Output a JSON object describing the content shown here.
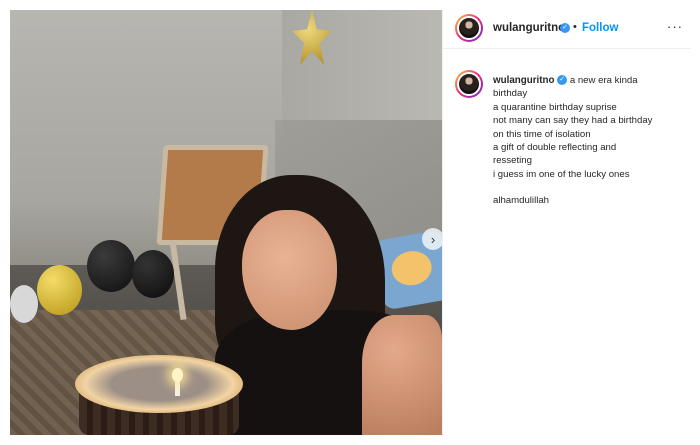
{
  "header": {
    "username": "wulanguritno",
    "separator": "•",
    "follow_label": "Follow",
    "more_label": "···",
    "verified_label": "✓"
  },
  "caption": {
    "username": "wulanguritno",
    "first_line": "a new era kinda",
    "lines": [
      "birthday",
      "a quarantine birthday suprise",
      "not many can say they had a birthday",
      "on this time of isolation",
      "a gift of double reflecting and",
      "resseting",
      "i guess im one of the lucky ones"
    ],
    "closing": "alhamdulillah"
  },
  "media": {
    "next_arrow": "›"
  },
  "colors": {
    "follow": "#0095f6",
    "verified": "#3897f0",
    "text": "#262626"
  },
  "icons": {
    "verified": "verified-badge-icon",
    "more": "more-options-icon",
    "next": "chevron-right-icon"
  }
}
